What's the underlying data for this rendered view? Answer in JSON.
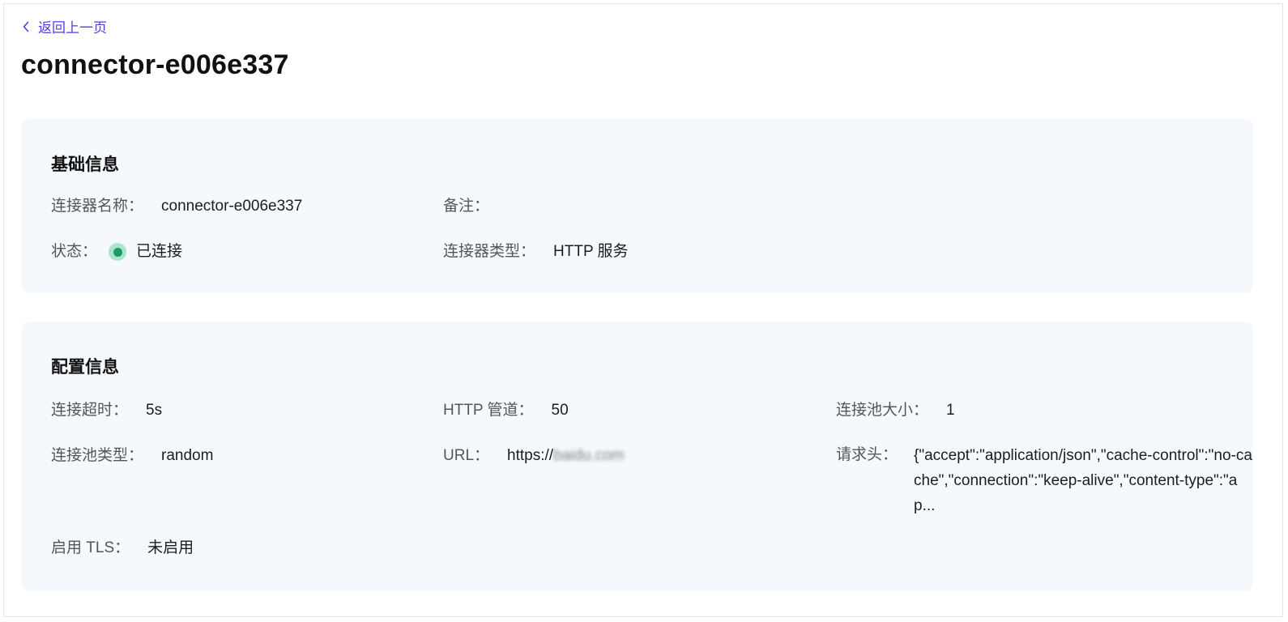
{
  "nav": {
    "back_label": "返回上一页"
  },
  "page": {
    "title": "connector-e006e337"
  },
  "basic_info": {
    "title": "基础信息",
    "name_label": "连接器名称：",
    "name_value": "connector-e006e337",
    "remark_label": "备注：",
    "remark_value": "",
    "status_label": "状态：",
    "status_value": "已连接",
    "type_label": "连接器类型：",
    "type_value": "HTTP 服务"
  },
  "config_info": {
    "title": "配置信息",
    "timeout_label": "连接超时：",
    "timeout_value": "5s",
    "pipeline_label": "HTTP 管道：",
    "pipeline_value": "50",
    "pool_size_label": "连接池大小：",
    "pool_size_value": "1",
    "pool_type_label": "连接池类型：",
    "pool_type_value": "random",
    "url_label": "URL：",
    "url_value_visible": "https://",
    "url_value_blurred": "baidu.com",
    "headers_label": "请求头：",
    "headers_value": "{\"accept\":\"application/json\",\"cache-control\":\"no-cache\",\"connection\":\"keep-alive\",\"content-type\":\"ap...",
    "tls_label": "启用 TLS：",
    "tls_value": "未启用"
  },
  "colors": {
    "accent": "#4e3de0",
    "card_bg": "#f5f8fc",
    "status_green": "#1c9a62",
    "status_green_light": "#a9e4ce"
  },
  "icons": {
    "back": "chevron-left-icon",
    "status": "status-dot-icon"
  }
}
